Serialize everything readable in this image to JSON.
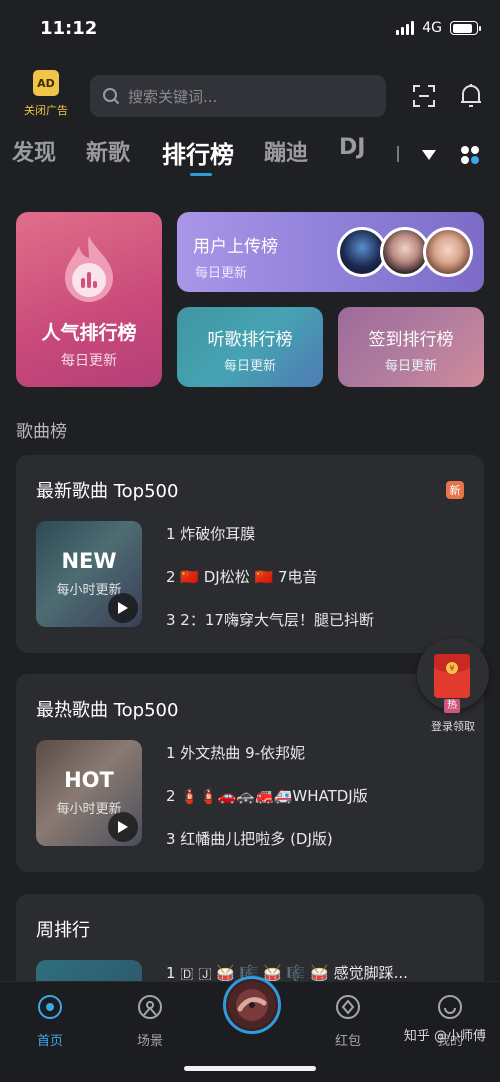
{
  "status_bar": {
    "time": "11:12",
    "network": "4G",
    "battery_level": 0.85
  },
  "header": {
    "ad_label": "关闭广告",
    "search_placeholder": "搜索关键词..."
  },
  "tabs": [
    {
      "label": "发现"
    },
    {
      "label": "新歌"
    },
    {
      "label": "排行榜",
      "active": true
    },
    {
      "label": "蹦迪"
    },
    {
      "label": "DJ"
    }
  ],
  "rank_cards": {
    "popular": {
      "title": "人气排行榜",
      "subtitle": "每日更新"
    },
    "upload": {
      "title": "用户上传榜",
      "subtitle": "每日更新"
    },
    "listen": {
      "title": "听歌排行榜",
      "subtitle": "每日更新"
    },
    "sign": {
      "title": "签到排行榜",
      "subtitle": "每日更新"
    }
  },
  "section_title": "歌曲榜",
  "charts": [
    {
      "title": "最新歌曲 Top500",
      "badge": "新",
      "cover_big": "NEW",
      "cover_small": "每小时更新",
      "tracks": [
        "1 炸破你耳膜",
        "2 🇨🇳 DJ松松 🇨🇳 7电音",
        "3 2：17嗨穿大气层！腿已抖断"
      ]
    },
    {
      "title": "最热歌曲 Top500",
      "cover_big": "HOT",
      "cover_small": "每小时更新",
      "tracks": [
        "1 外文热曲 9-依邦妮",
        "2 🧯🧯🚗🚓🚒🚑WHATDJ版",
        "3  红幡曲儿把啦多 (DJ版)"
      ]
    },
    {
      "title": "周排行",
      "tracks": [
        "1 🇩  🇯 🥁 🎼 🥁 🎼 🥁 感觉脚踩..."
      ]
    }
  ],
  "red_packet": {
    "hot_label": "热",
    "label": "登录领取"
  },
  "bottom_nav": [
    {
      "label": "首页",
      "active": true
    },
    {
      "label": "场景"
    },
    {
      "label": "红包"
    },
    {
      "label": "我的"
    }
  ],
  "watermark": "知乎 @小师傅",
  "colors": {
    "accent": "#2f9bdc",
    "background": "#1f2023",
    "card": "#2b2c30"
  }
}
